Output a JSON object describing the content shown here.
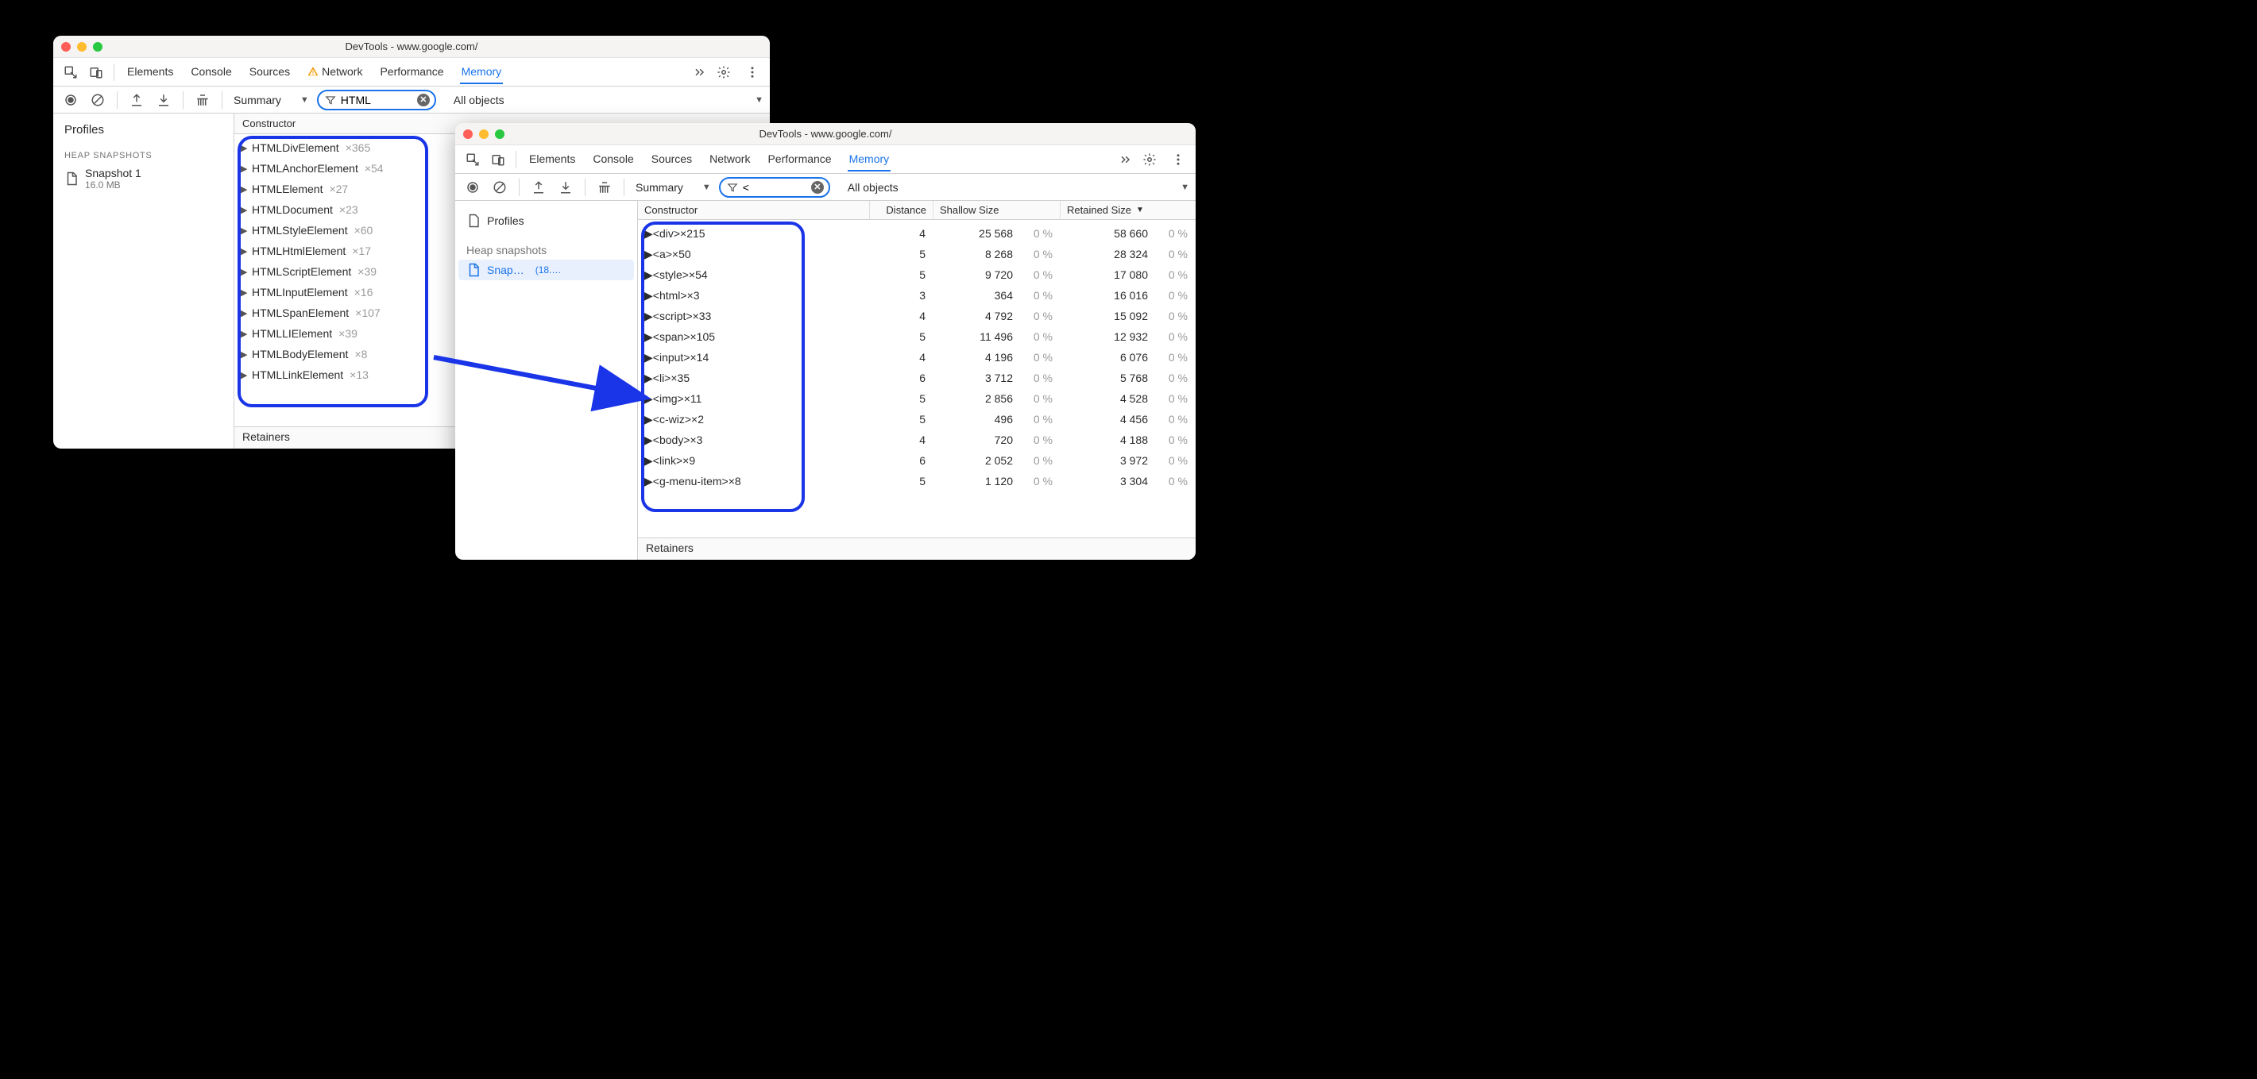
{
  "left": {
    "title": "DevTools - www.google.com/",
    "tabs": [
      "Elements",
      "Console",
      "Sources",
      "Network",
      "Performance",
      "Memory"
    ],
    "activeTab": "Memory",
    "networkWarn": true,
    "summaryLabel": "Summary",
    "filterValue": "HTML",
    "allObjectsLabel": "All objects",
    "sidebar": {
      "profilesLabel": "Profiles",
      "sectionLabel": "HEAP SNAPSHOTS",
      "snapshotName": "Snapshot 1",
      "snapshotSize": "16.0 MB"
    },
    "constructorHeader": "Constructor",
    "rows": [
      {
        "name": "HTMLDivElement",
        "count": "×365"
      },
      {
        "name": "HTMLAnchorElement",
        "count": "×54"
      },
      {
        "name": "HTMLElement",
        "count": "×27"
      },
      {
        "name": "HTMLDocument",
        "count": "×23"
      },
      {
        "name": "HTMLStyleElement",
        "count": "×60"
      },
      {
        "name": "HTMLHtmlElement",
        "count": "×17"
      },
      {
        "name": "HTMLScriptElement",
        "count": "×39"
      },
      {
        "name": "HTMLInputElement",
        "count": "×16"
      },
      {
        "name": "HTMLSpanElement",
        "count": "×107"
      },
      {
        "name": "HTMLLIElement",
        "count": "×39"
      },
      {
        "name": "HTMLBodyElement",
        "count": "×8"
      },
      {
        "name": "HTMLLinkElement",
        "count": "×13"
      }
    ],
    "retainersLabel": "Retainers"
  },
  "right": {
    "title": "DevTools - www.google.com/",
    "tabs": [
      "Elements",
      "Console",
      "Sources",
      "Network",
      "Performance",
      "Memory"
    ],
    "activeTab": "Memory",
    "summaryLabel": "Summary",
    "filterValue": "<",
    "allObjectsLabel": "All objects",
    "sidebar": {
      "profilesLabel": "Profiles",
      "sectionLabel": "Heap snapshots",
      "snapshotName": "Snap…",
      "snapshotDetail": "(18.…"
    },
    "columns": {
      "constructor": "Constructor",
      "distance": "Distance",
      "shallow": "Shallow Size",
      "retained": "Retained Size"
    },
    "rows": [
      {
        "name": "<div>",
        "count": "×215",
        "dist": "4",
        "shal": "25 568",
        "spc": "0 %",
        "ret": "58 660",
        "rpc": "0 %"
      },
      {
        "name": "<a>",
        "count": "×50",
        "dist": "5",
        "shal": "8 268",
        "spc": "0 %",
        "ret": "28 324",
        "rpc": "0 %"
      },
      {
        "name": "<style>",
        "count": "×54",
        "dist": "5",
        "shal": "9 720",
        "spc": "0 %",
        "ret": "17 080",
        "rpc": "0 %"
      },
      {
        "name": "<html>",
        "count": "×3",
        "dist": "3",
        "shal": "364",
        "spc": "0 %",
        "ret": "16 016",
        "rpc": "0 %"
      },
      {
        "name": "<script>",
        "count": "×33",
        "dist": "4",
        "shal": "4 792",
        "spc": "0 %",
        "ret": "15 092",
        "rpc": "0 %"
      },
      {
        "name": "<span>",
        "count": "×105",
        "dist": "5",
        "shal": "11 496",
        "spc": "0 %",
        "ret": "12 932",
        "rpc": "0 %"
      },
      {
        "name": "<input>",
        "count": "×14",
        "dist": "4",
        "shal": "4 196",
        "spc": "0 %",
        "ret": "6 076",
        "rpc": "0 %"
      },
      {
        "name": "<li>",
        "count": "×35",
        "dist": "6",
        "shal": "3 712",
        "spc": "0 %",
        "ret": "5 768",
        "rpc": "0 %"
      },
      {
        "name": "<img>",
        "count": "×11",
        "dist": "5",
        "shal": "2 856",
        "spc": "0 %",
        "ret": "4 528",
        "rpc": "0 %"
      },
      {
        "name": "<c-wiz>",
        "count": "×2",
        "dist": "5",
        "shal": "496",
        "spc": "0 %",
        "ret": "4 456",
        "rpc": "0 %"
      },
      {
        "name": "<body>",
        "count": "×3",
        "dist": "4",
        "shal": "720",
        "spc": "0 %",
        "ret": "4 188",
        "rpc": "0 %"
      },
      {
        "name": "<link>",
        "count": "×9",
        "dist": "6",
        "shal": "2 052",
        "spc": "0 %",
        "ret": "3 972",
        "rpc": "0 %"
      },
      {
        "name": "<g-menu-item>",
        "count": "×8",
        "dist": "5",
        "shal": "1 120",
        "spc": "0 %",
        "ret": "3 304",
        "rpc": "0 %"
      }
    ],
    "retainersLabel": "Retainers"
  }
}
